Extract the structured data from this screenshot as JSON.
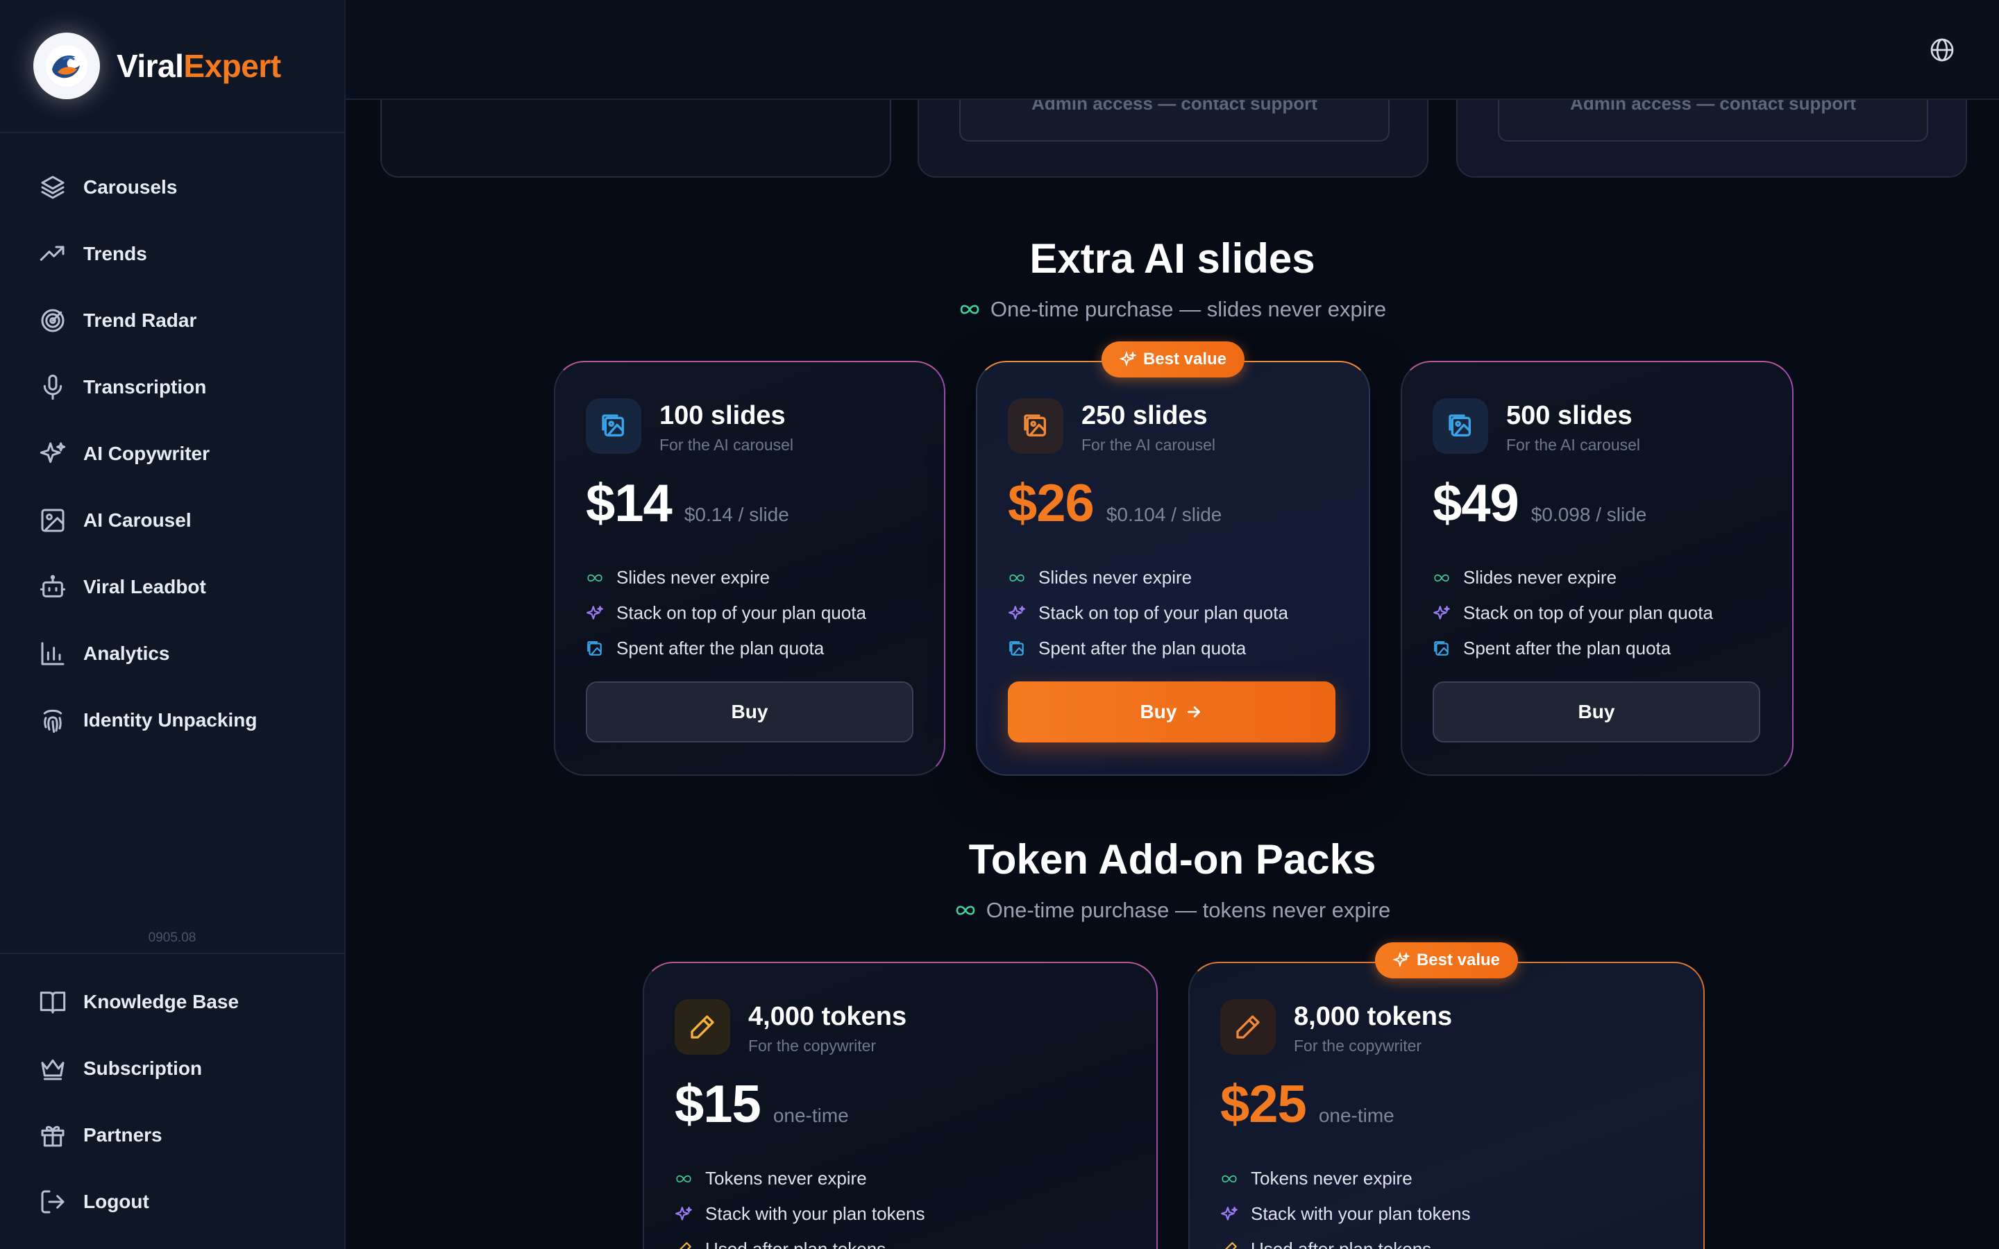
{
  "brand": {
    "name_part1": "Viral",
    "name_part2": "Expert"
  },
  "sidebar": {
    "items": [
      {
        "label": "Carousels",
        "icon": "layers-icon"
      },
      {
        "label": "Trends",
        "icon": "trending-up-icon"
      },
      {
        "label": "Trend Radar",
        "icon": "radar-icon"
      },
      {
        "label": "Transcription",
        "icon": "microphone-icon"
      },
      {
        "label": "AI Copywriter",
        "icon": "sparkles-icon"
      },
      {
        "label": "AI Carousel",
        "icon": "images-icon"
      },
      {
        "label": "Viral Leadbot",
        "icon": "bot-icon"
      },
      {
        "label": "Analytics",
        "icon": "bar-chart-icon"
      },
      {
        "label": "Identity Unpacking",
        "icon": "fingerprint-icon"
      }
    ],
    "version": "0905.08",
    "bottom_items": [
      {
        "label": "Knowledge Base",
        "icon": "book-icon"
      },
      {
        "label": "Subscription",
        "icon": "crown-icon"
      },
      {
        "label": "Partners",
        "icon": "gift-icon"
      },
      {
        "label": "Logout",
        "icon": "logout-icon"
      }
    ]
  },
  "topbar": {
    "icon": "globe-icon"
  },
  "plans": {
    "admin_text": "Admin access — contact support"
  },
  "slides_section": {
    "title": "Extra AI slides",
    "subtitle": "One-time purchase — slides never expire",
    "badge": "Best value",
    "cards": [
      {
        "title": "100 slides",
        "desc": "For the AI carousel",
        "price": "$14",
        "per": "$0.14 / slide",
        "features": [
          "Slides never expire",
          "Stack on top of your plan quota",
          "Spent after the plan quota"
        ],
        "buy": "Buy"
      },
      {
        "title": "250 slides",
        "desc": "For the AI carousel",
        "price": "$26",
        "per": "$0.104 / slide",
        "features": [
          "Slides never expire",
          "Stack on top of your plan quota",
          "Spent after the plan quota"
        ],
        "buy": "Buy"
      },
      {
        "title": "500 slides",
        "desc": "For the AI carousel",
        "price": "$49",
        "per": "$0.098 / slide",
        "features": [
          "Slides never expire",
          "Stack on top of your plan quota",
          "Spent after the plan quota"
        ],
        "buy": "Buy"
      }
    ]
  },
  "tokens_section": {
    "title": "Token Add-on Packs",
    "subtitle": "One-time purchase — tokens never expire",
    "badge": "Best value",
    "cards": [
      {
        "title": "4,000 tokens",
        "desc": "For the copywriter",
        "price": "$15",
        "per": "one-time",
        "features": [
          "Tokens never expire",
          "Stack with your plan tokens",
          "Used after plan tokens"
        ]
      },
      {
        "title": "8,000 tokens",
        "desc": "For the copywriter",
        "price": "$25",
        "per": "one-time",
        "features": [
          "Tokens never expire",
          "Stack with your plan tokens",
          "Used after plan tokens"
        ]
      }
    ]
  },
  "colors": {
    "accent": "#f47a20",
    "background": "#070b16",
    "sidebar": "#0f1626",
    "positive": "#3fd29a"
  }
}
